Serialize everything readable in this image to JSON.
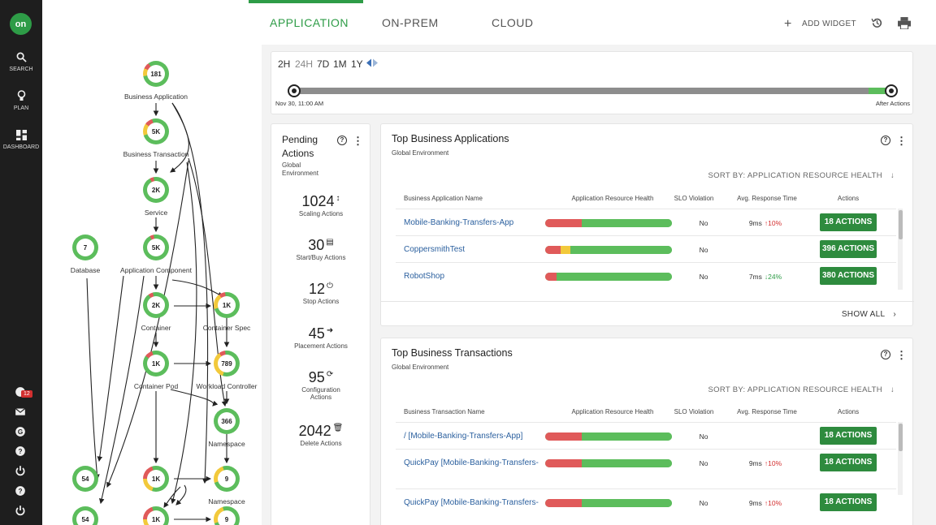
{
  "nav": {
    "logo": "on",
    "items": [
      {
        "label": "SEARCH",
        "icon": "search-icon"
      },
      {
        "label": "PLAN",
        "icon": "lightbulb-icon"
      },
      {
        "label": "DASHBOARD",
        "icon": "dashboard-icon"
      }
    ],
    "notification_count": "12",
    "bottom_icons": [
      "notification-icon",
      "mail-icon",
      "refresh-icon",
      "help-icon",
      "power-icon",
      "help-icon",
      "power-icon"
    ]
  },
  "topology": {
    "nodes": [
      {
        "name": "Business Application",
        "value": "181"
      },
      {
        "name": "Business Transaction",
        "value": "5K"
      },
      {
        "name": "Service",
        "value": "2K"
      },
      {
        "name": "Application Component",
        "value": "5K"
      },
      {
        "name": "Database",
        "value": "7"
      },
      {
        "name": "Container",
        "value": "2K"
      },
      {
        "name": "Container Spec",
        "value": "1K"
      },
      {
        "name": "Container Pod",
        "value": "1K"
      },
      {
        "name": "Workload Controller",
        "value": "789"
      },
      {
        "name": "Namespace",
        "value": "366"
      },
      {
        "name": "",
        "value": "54"
      },
      {
        "name": "",
        "value": "1K"
      },
      {
        "name": "Namespace",
        "value": "9"
      },
      {
        "name": "",
        "value": "54"
      },
      {
        "name": "",
        "value": "1K"
      },
      {
        "name": "",
        "value": "9"
      }
    ]
  },
  "tabs": [
    "APPLICATION",
    "ON-PREM",
    "CLOUD"
  ],
  "toolbar": {
    "add_widget": "ADD WIDGET",
    "icons": [
      "plus-icon",
      "history-icon",
      "print-icon"
    ]
  },
  "timeline": {
    "ranges": [
      "2H",
      "24H",
      "7D",
      "1M",
      "1Y"
    ],
    "selected": "24H",
    "start_label": "Nov 30, 11:00 AM",
    "end_label": "After Actions"
  },
  "pending_actions": {
    "title": "Pending Actions",
    "subtitle": "Global Environment",
    "items": [
      {
        "count": "1024",
        "label": "Scaling Actions",
        "icon": "scale-icon"
      },
      {
        "count": "30",
        "label": "Start/Buy Actions",
        "icon": "server-icon"
      },
      {
        "count": "12",
        "label": "Stop Actions",
        "icon": "power-icon"
      },
      {
        "count": "45",
        "label": "Placement Actions",
        "icon": "arrow-right-icon"
      },
      {
        "count": "95",
        "label": "Configuration Actions",
        "icon": "refresh-icon"
      },
      {
        "count": "2042",
        "label": "Delete Actions",
        "icon": "trash-icon"
      }
    ]
  },
  "top_apps": {
    "title": "Top Business Applications",
    "subtitle": "Global Environment",
    "sort": "SORT BY: APPLICATION RESOURCE HEALTH",
    "columns": [
      "Business Application Name",
      "Application Resource Health",
      "SLO Violation",
      "Avg. Response Time",
      "Actions"
    ],
    "rows": [
      {
        "name": "Mobile-Banking-Transfers-App",
        "health": {
          "red": 0.29,
          "yellow": 0,
          "green": 0.71
        },
        "slo": "No",
        "resp": "9ms",
        "trend": "10%",
        "dir": "up",
        "actions": "18 ACTIONS"
      },
      {
        "name": "CoppersmithTest",
        "health": {
          "red": 0.12,
          "yellow": 0.08,
          "green": 0.8
        },
        "slo": "No",
        "resp": "",
        "trend": "",
        "dir": "",
        "actions": "396 ACTIONS"
      },
      {
        "name": "RobotShop",
        "health": {
          "red": 0.09,
          "yellow": 0,
          "green": 0.91
        },
        "slo": "No",
        "resp": "7ms",
        "trend": "24%",
        "dir": "down",
        "actions": "380 ACTIONS"
      }
    ],
    "show_all": "SHOW ALL"
  },
  "top_trans": {
    "title": "Top Business Transactions",
    "subtitle": "Global Environment",
    "sort": "SORT BY: APPLICATION RESOURCE HEALTH",
    "columns": [
      "Business Transaction Name",
      "Application Resource Health",
      "SLO Violation",
      "Avg. Response Time",
      "Actions"
    ],
    "rows": [
      {
        "name": "/ [Mobile-Banking-Transfers-App]",
        "health": {
          "red": 0.29,
          "yellow": 0,
          "green": 0.71
        },
        "slo": "No",
        "resp": "",
        "trend": "",
        "dir": "",
        "actions": "18 ACTIONS"
      },
      {
        "name": "QuickPay [Mobile-Banking-Transfers-",
        "health": {
          "red": 0.29,
          "yellow": 0,
          "green": 0.71
        },
        "slo": "No",
        "resp": "9ms",
        "trend": "10%",
        "dir": "up",
        "actions": "18 ACTIONS"
      },
      {
        "name": "QuickPay [Mobile-Banking-Transfers-",
        "health": {
          "red": 0.29,
          "yellow": 0,
          "green": 0.71
        },
        "slo": "No",
        "resp": "9ms",
        "trend": "10%",
        "dir": "up",
        "actions": "18 ACTIONS"
      }
    ]
  },
  "colors": {
    "accent": "#2e9c47",
    "button": "#2e8b3e",
    "link": "#2a5f9e",
    "bad": "#e05a5a",
    "warn": "#f2c93b",
    "good": "#5cbd5c"
  }
}
